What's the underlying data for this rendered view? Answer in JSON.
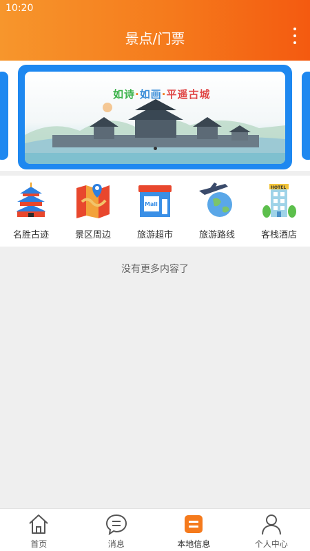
{
  "status": {
    "time": "10:20"
  },
  "header": {
    "title": "景点/门票"
  },
  "banner": {
    "text_parts": [
      "如诗",
      "·",
      "如画",
      "·",
      "平遥古城"
    ]
  },
  "categories": [
    {
      "label": "名胜古迹",
      "icon": "temple-icon"
    },
    {
      "label": "景区周边",
      "icon": "map-pin-icon"
    },
    {
      "label": "旅游超市",
      "icon": "mall-icon"
    },
    {
      "label": "旅游路线",
      "icon": "globe-plane-icon"
    },
    {
      "label": "客栈酒店",
      "icon": "hotel-icon"
    }
  ],
  "no_more_text": "没有更多内容了",
  "tabbar": [
    {
      "label": "首页",
      "icon": "home-icon",
      "active": false
    },
    {
      "label": "消息",
      "icon": "message-icon",
      "active": false
    },
    {
      "label": "本地信息",
      "icon": "local-info-icon",
      "active": true
    },
    {
      "label": "个人中心",
      "icon": "person-icon",
      "active": false
    }
  ],
  "colors": {
    "accent": "#f57a1c",
    "banner_border": "#1e88f0"
  }
}
